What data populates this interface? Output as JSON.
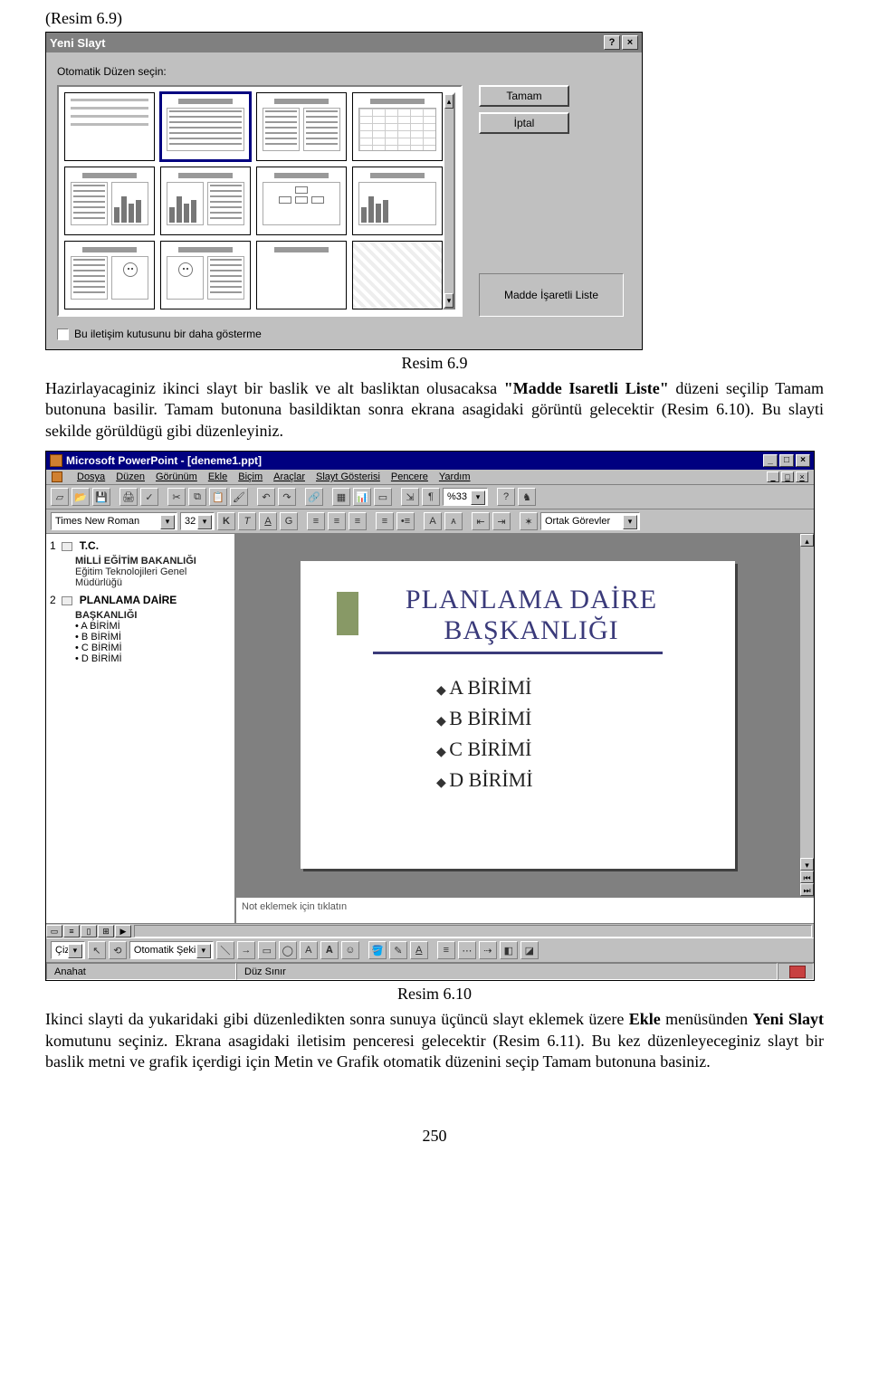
{
  "page": {
    "caption_top": "(Resim 6.9)",
    "caption_69": "Resim 6.9",
    "paragraph1_a": "Hazirlayacaginiz ikinci slayt bir baslik ve alt basliktan olusacaksa ",
    "paragraph1_bold1": "\"Madde Isaretli Liste\"",
    "paragraph1_b": " düzeni seçilip Tamam butonuna basilir. Tamam butonuna basildiktan sonra ekrana asagidaki görüntü gelecektir (Resim 6.10). Bu slayti sekilde görüldügü gibi düzenleyiniz.",
    "caption_610": "Resim 6.10",
    "paragraph2_a": "Ikinci slayti da yukaridaki gibi düzenledikten sonra sunuya üçüncü slayt eklemek üzere ",
    "paragraph2_bold1": "Ekle",
    "paragraph2_b": " menüsünden ",
    "paragraph2_bold2": "Yeni Slayt",
    "paragraph2_c": "   komutunu seçiniz. Ekrana asagidaki iletisim penceresi gelecektir (Resim 6.11). Bu kez düzenleyeceginiz slayt bir baslik metni ve grafik içerdigi için Metin ve Grafik otomatik düzenini seçip Tamam butonuna basiniz.",
    "page_number": "250"
  },
  "dialog": {
    "title": "Yeni Slayt",
    "help_btn": "?",
    "close_btn": "×",
    "prompt": "Otomatik Düzen seçin:",
    "ok_btn": "Tamam",
    "cancel_btn": "İptal",
    "preview_label": "Madde İşaretli Liste",
    "checkbox_label": "Bu iletişim kutusunu bir daha gösterme",
    "scroll_up": "▴",
    "scroll_down": "▾"
  },
  "pp": {
    "title": "Microsoft PowerPoint - [deneme1.ppt]",
    "win_min": "_",
    "win_max": "□",
    "win_close": "×",
    "menu": [
      "Dosya",
      "Düzen",
      "Görünüm",
      "Ekle",
      "Biçim",
      "Araçlar",
      "Slayt Gösterisi",
      "Pencere",
      "Yardım"
    ],
    "zoom": "%33",
    "font_name": "Times New Roman",
    "font_size": "32",
    "common_tasks": "Ortak Görevler",
    "draw_menu": "Çiz",
    "autoshape": "Otomatik Şekil",
    "notes_placeholder": "Not eklemek için tıklatın",
    "status_left": "Anahat",
    "status_mid": "Düz Sınır",
    "outline": {
      "s1_num": "1",
      "s1_title": "T.C.",
      "s1_line2": "MİLLİ EĞİTİM BAKANLIĞI",
      "s1_sub1": "Eğitim Teknolojileri Genel",
      "s1_sub2": "Müdürlüğü",
      "s2_num": "2",
      "s2_title1": "PLANLAMA DAİRE",
      "s2_title2": "BAŞKANLIĞI",
      "s2_b1": "A BİRİMİ",
      "s2_b2": "B BİRİMİ",
      "s2_b3": "C BİRİMİ",
      "s2_b4": "D BİRİMİ"
    },
    "slide": {
      "title1": "PLANLAMA DAİRE",
      "title2": "BAŞKANLIĞI",
      "b1": "A BİRİMİ",
      "b2": "B BİRİMİ",
      "b3": "C BİRİMİ",
      "b4": "D BİRİMİ"
    }
  }
}
